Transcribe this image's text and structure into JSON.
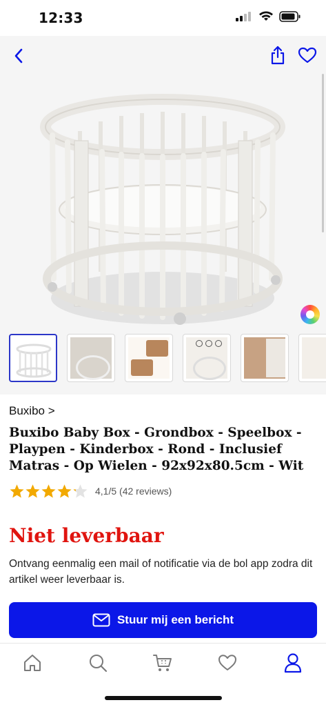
{
  "status_bar": {
    "time": "12:33"
  },
  "colors": {
    "accent": "#0b17e8",
    "availability": "#e0140f",
    "star": "#f2a900",
    "nav_active": "#0b17e8"
  },
  "hero": {
    "icons": [
      "chevron-left-icon",
      "share-icon",
      "heart-icon",
      "color-wheel-icon"
    ]
  },
  "gallery": {
    "thumbnail_count": 6,
    "selected_index": 0
  },
  "product": {
    "brand": "Buxibo",
    "brand_chevron": ">",
    "title": "Buxibo Baby Box - Grondbox - Speelbox - Playpen - Kinderbox - Rond - Inclusief Matras - Op Wielen - 92x92x80.5cm - Wit",
    "rating_value": 4.1,
    "rating_text": "4,1/5 (42 reviews)",
    "availability": "Niet leverbaar",
    "notify_text": "Ontvang eenmalig een mail of notificatie via de bol app zodra dit artikel weer leverbaar is.",
    "notify_button_label": "Stuur mij een bericht"
  },
  "bottom_nav": {
    "items": [
      "home-icon",
      "search-icon",
      "cart-icon",
      "heart-icon",
      "user-icon"
    ],
    "active": "user-icon"
  }
}
